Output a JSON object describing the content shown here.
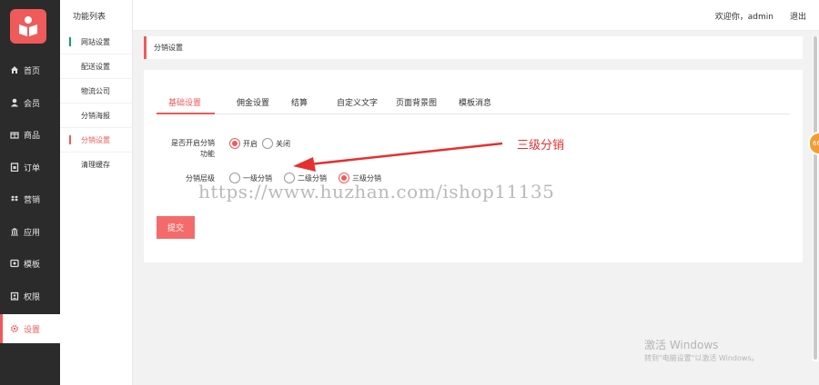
{
  "brand": {
    "accent": "#f05a5a",
    "sidebar_bg": "#2b2b2b",
    "selected_green": "#1a9b6a"
  },
  "sidebar": {
    "items": [
      {
        "label": "首页",
        "icon": "home-icon"
      },
      {
        "label": "会员",
        "icon": "user-icon"
      },
      {
        "label": "商品",
        "icon": "gift-icon"
      },
      {
        "label": "订单",
        "icon": "order-icon"
      },
      {
        "label": "营销",
        "icon": "dropbox-icon"
      },
      {
        "label": "应用",
        "icon": "bank-icon"
      },
      {
        "label": "模板",
        "icon": "template-icon"
      },
      {
        "label": "权限",
        "icon": "lock-icon"
      },
      {
        "label": "设置",
        "icon": "gear-icon"
      }
    ]
  },
  "submenu": {
    "title": "功能列表",
    "items": [
      "网站设置",
      "配送设置",
      "物流公司",
      "分销海报",
      "分销设置",
      "清理缓存"
    ]
  },
  "topbar": {
    "welcome": "欢迎你，admin",
    "logout": "退出"
  },
  "breadcrumb": "分销设置",
  "tabs": [
    "基础设置",
    "佣金设置",
    "结算",
    "自定义文字",
    "页面背景图",
    "模板消息"
  ],
  "form": {
    "enable_label_1": "是否开启分销",
    "enable_label_2": "功能",
    "enable_options": [
      "开启",
      "关闭"
    ],
    "level_label": "分销层级",
    "level_options": [
      "一级分销",
      "二级分销",
      "三级分销"
    ],
    "submit": "提交"
  },
  "annotation": {
    "text": "三级分销"
  },
  "watermark": "https://www.huzhan.com/ishop11135",
  "windows": {
    "title": "激活 Windows",
    "sub": "转到\"电脑设置\"以激活 Windows。"
  },
  "float_badge": "66"
}
